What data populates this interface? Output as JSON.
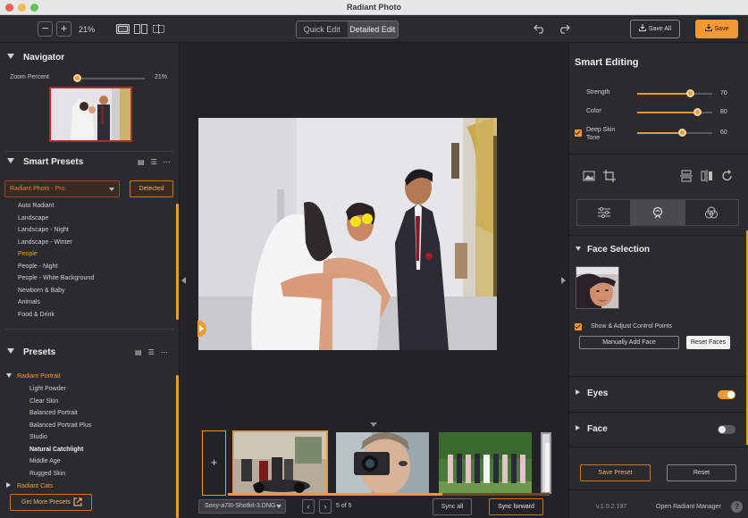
{
  "window": {
    "title": "Radiant Photo"
  },
  "colors": {
    "accent": "#f19a35",
    "close": "#ed5f57",
    "minimize": "#f5be4f",
    "maximize": "#61c454"
  },
  "toolbar": {
    "zoom_out_label": "−",
    "zoom_in_label": "+",
    "zoom_value": "21%",
    "mode_quick": "Quick Edit",
    "mode_detailed": "Detailed Edit",
    "save_all_label": "Save All",
    "save_label": "Save"
  },
  "navigator": {
    "title": "Navigator",
    "zoom_label": "Zoom Percent",
    "zoom_value": "21%",
    "zoom_fraction": 0.04
  },
  "smart_presets": {
    "title": "Smart Presets",
    "selected": "Radiant Photo - Pro",
    "detected_label": "Detected",
    "items": [
      {
        "label": "Auto Radiant",
        "state": ""
      },
      {
        "label": "Landscape",
        "state": ""
      },
      {
        "label": "Landscape - Night",
        "state": ""
      },
      {
        "label": "Landscape - Winter",
        "state": ""
      },
      {
        "label": "People",
        "state": "active"
      },
      {
        "label": "People - Night",
        "state": ""
      },
      {
        "label": "People - White Background",
        "state": ""
      },
      {
        "label": "Newborn & Baby",
        "state": ""
      },
      {
        "label": "Animals",
        "state": ""
      },
      {
        "label": "Food & Drink",
        "state": ""
      }
    ]
  },
  "presets": {
    "title": "Presets",
    "group_open": "Radiant Portrait",
    "items": [
      {
        "label": "Light Powder",
        "state": ""
      },
      {
        "label": "Clear Skin",
        "state": ""
      },
      {
        "label": "Balanced Portrait",
        "state": ""
      },
      {
        "label": "Balanced Portrait Plus",
        "state": ""
      },
      {
        "label": "Studio",
        "state": ""
      },
      {
        "label": "Natural Catchlight",
        "state": "bold"
      },
      {
        "label": "Middle Age",
        "state": ""
      },
      {
        "label": "Rugged Skin",
        "state": ""
      }
    ],
    "group_closed": "Radiant Cats",
    "get_more_label": "Get More Presets"
  },
  "filmstrip": {
    "file_name": "Sony-a7III-Shotkit-3.DNG",
    "page_text": "5 of 5",
    "sync_all_label": "Sync all",
    "sync_forward_label": "Sync forward"
  },
  "smart_editing": {
    "title": "Smart Editing",
    "sliders": [
      {
        "label": "Strength",
        "value": 70,
        "max": 100
      },
      {
        "label": "Color",
        "value": 80,
        "max": 100
      },
      {
        "label": "Deep Skin Tone",
        "value": 60,
        "max": 100
      }
    ],
    "deep_skin_line1": "Deep Skin",
    "deep_skin_line2": "Tone"
  },
  "face_selection": {
    "title": "Face Selection",
    "show_points_label": "Show & Adjust Control Points",
    "manual_add_label": "Manually Add Face",
    "reset_faces_label": "Reset Faces"
  },
  "sections": {
    "eyes_label": "Eyes",
    "eyes_on": true,
    "face_label": "Face",
    "face_on": false
  },
  "footer": {
    "save_preset_label": "Save Preset",
    "reset_label": "Reset",
    "version": "v.1.0.2.197",
    "manager_label": "Open Radiant Manager",
    "help_label": "?"
  },
  "icons": [
    "zoom-out-icon",
    "zoom-in-icon",
    "single-view-icon",
    "split-view-icon",
    "compare-view-icon",
    "undo-icon",
    "redo-icon",
    "download-icon",
    "grid-view-icon",
    "list-view-icon",
    "more-icon",
    "external-link-icon",
    "photo-icon",
    "crop-icon",
    "flip-vertical-icon",
    "flip-horizontal-icon",
    "rotate-icon",
    "sliders-icon",
    "portrait-icon",
    "color-circles-icon"
  ]
}
